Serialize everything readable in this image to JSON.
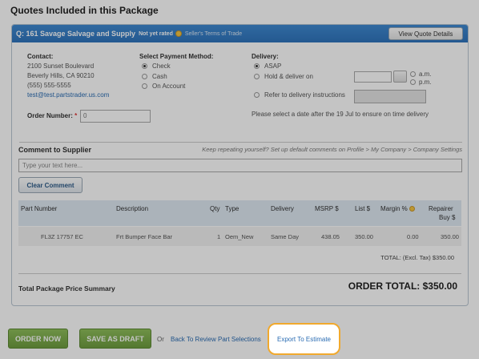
{
  "page_title": "Quotes Included in this Package",
  "quote": {
    "supplier_name": "Q: 161 Savage Salvage and Supply",
    "rating": "Not yet rated",
    "terms_link": "Seller's Terms of Trade",
    "view_button": "View Quote Details"
  },
  "contact": {
    "label": "Contact:",
    "address1": "2100 Sunset Boulevard",
    "address2": "Beverly Hills, CA 90210",
    "phone": "(555) 555-5555",
    "email": "test@test.partstrader.us.com"
  },
  "payment": {
    "label": "Select Payment Method:",
    "options": [
      "Check",
      "Cash",
      "On Account"
    ],
    "selected": "Check"
  },
  "delivery": {
    "label": "Delivery:",
    "options": [
      "ASAP",
      "Hold & deliver on",
      "Refer to delivery instructions"
    ],
    "selected": "ASAP",
    "am": "a.m.",
    "pm": "p.m.",
    "note": "Please select a date after the 19 Jul to ensure on time delivery"
  },
  "order_number": {
    "label": "Order Number:",
    "required_mark": "*",
    "value": "0"
  },
  "comment": {
    "title": "Comment to Supplier",
    "hint": "Keep repeating yourself? Set up default comments on Profile > My Company > Company Settings",
    "placeholder": "Type your text here...",
    "clear_button": "Clear Comment"
  },
  "table": {
    "headers": {
      "part_number": "Part Number",
      "description": "Description",
      "qty": "Qty",
      "type": "Type",
      "delivery": "Delivery",
      "msrp": "MSRP $",
      "list": "List $",
      "margin": "Margin %",
      "repairer_buy_1": "Repairer",
      "repairer_buy_2": "Buy $"
    },
    "rows": [
      {
        "part_number": "FL3Z 17757 EC",
        "description": "Frt Bumper Face Bar",
        "qty": "1",
        "type": "Oem_New",
        "delivery": "Same Day",
        "msrp": "438.05",
        "list": "350.00",
        "margin": "0.00",
        "repairer_buy": "350.00"
      }
    ]
  },
  "totals": {
    "tax_line": "TOTAL: (Excl. Tax) $350.00",
    "summary_label": "Total Package Price Summary",
    "order_total": "ORDER TOTAL: $350.00"
  },
  "footer": {
    "order_now": "ORDER NOW",
    "save_draft": "SAVE AS DRAFT",
    "or": "Or",
    "back_link": "Back To Review Part Selections",
    "export": "Export To Estimate"
  },
  "colors": {
    "header_blue": "#3f8ad1",
    "button_green": "#7aa84a",
    "highlight_orange": "#f1a92d",
    "link_blue": "#2a6cb3"
  }
}
